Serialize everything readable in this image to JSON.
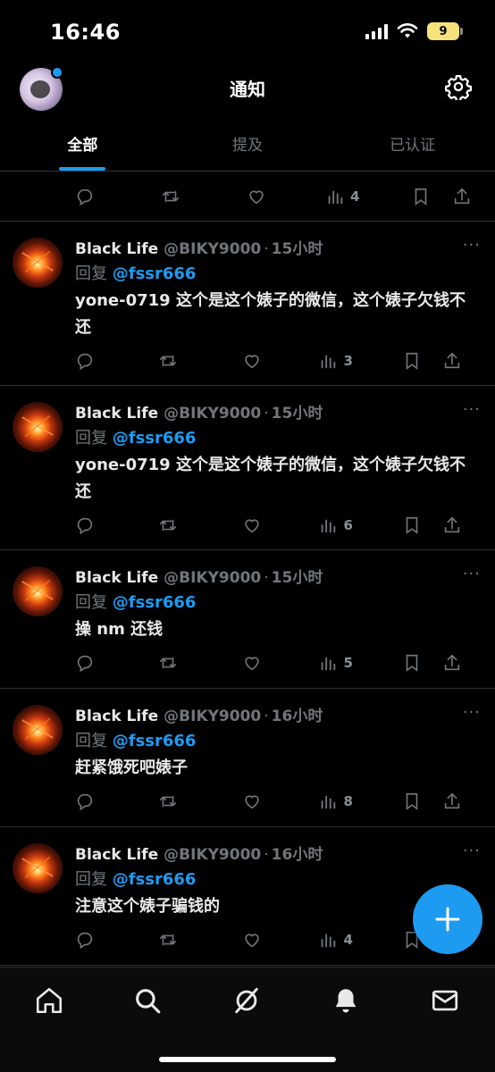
{
  "status_bar": {
    "time": "16:46",
    "battery": "9"
  },
  "header": {
    "title": "通知"
  },
  "tabs": [
    {
      "label": "全部",
      "active": true
    },
    {
      "label": "提及",
      "active": false
    },
    {
      "label": "已认证",
      "active": false
    }
  ],
  "top_partial": {
    "views": "4"
  },
  "tweets": [
    {
      "name": "Black Life",
      "handle": "@BIKY9000",
      "dot": "·",
      "time": "15小时",
      "reply_prefix": "回复",
      "reply_to": "@fssr666",
      "text": "yone-0719 这个是这个婊子的微信，这个婊子欠钱不还",
      "views": "3"
    },
    {
      "name": "Black Life",
      "handle": "@BIKY9000",
      "dot": "·",
      "time": "15小时",
      "reply_prefix": "回复",
      "reply_to": "@fssr666",
      "text": "yone-0719 这个是这个婊子的微信，这个婊子欠钱不还",
      "views": "6"
    },
    {
      "name": "Black Life",
      "handle": "@BIKY9000",
      "dot": "·",
      "time": "15小时",
      "reply_prefix": "回复",
      "reply_to": "@fssr666",
      "text": "操 nm 还钱",
      "views": "5"
    },
    {
      "name": "Black Life",
      "handle": "@BIKY9000",
      "dot": "·",
      "time": "16小时",
      "reply_prefix": "回复",
      "reply_to": "@fssr666",
      "text": "赶紧饿死吧婊子",
      "views": "8"
    },
    {
      "name": "Black Life",
      "handle": "@BIKY9000",
      "dot": "·",
      "time": "16小时",
      "reply_prefix": "回复",
      "reply_to": "@fssr666",
      "text": "注意这个婊子骗钱的",
      "views": "4"
    }
  ],
  "more_label": "···",
  "fab": {
    "icon": "plus-icon"
  },
  "bottom_nav": [
    "home-icon",
    "search-icon",
    "grok-icon",
    "bell-icon",
    "mail-icon"
  ],
  "colors": {
    "accent": "#1d9bf0",
    "muted": "#71767b",
    "text": "#e7e9ea",
    "background": "#000000"
  }
}
